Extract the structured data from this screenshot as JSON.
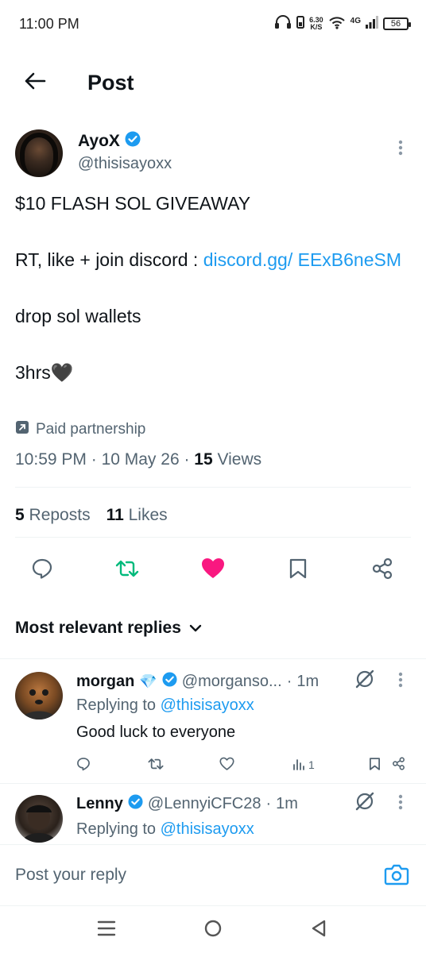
{
  "status_bar": {
    "time": "11:00 PM",
    "net_speed_value": "6.30",
    "net_speed_unit": "K/S",
    "network_type": "4G",
    "battery": "56"
  },
  "header": {
    "title": "Post"
  },
  "tweet": {
    "author_name": "AyoX",
    "author_handle": "@thisisayoxx",
    "line1": "$10 FLASH SOL GIVEAWAY",
    "line2_prefix": "RT, like + join discord : ",
    "line2_link": "discord.gg/ EExB6neSM",
    "line3": "drop sol wallets",
    "line4": "3hrs🖤",
    "paid_label": "Paid partnership",
    "time": "10:59 PM",
    "date": "10 May 26",
    "views_count": "15",
    "views_label": "Views",
    "reposts_count": "5",
    "reposts_label": "Reposts",
    "likes_count": "11",
    "likes_label": "Likes"
  },
  "sort_label": "Most relevant replies",
  "replies": [
    {
      "name": "morgan",
      "badge": "💎",
      "handle": "@morganso...",
      "time": "1m",
      "replying_prefix": "Replying to ",
      "replying_handle": "@thisisayoxx",
      "text": "Good luck to everyone",
      "views": "1"
    },
    {
      "name": "Lenny",
      "handle": "@LennyiCFC28",
      "time": "1m",
      "replying_prefix": "Replying to ",
      "replying_handle": "@thisisayoxx"
    }
  ],
  "compose": {
    "placeholder": "Post your reply"
  },
  "colors": {
    "accent": "#1d9bf0",
    "like": "#f91880",
    "repost": "#00ba7c",
    "secondary_text": "#536471"
  }
}
